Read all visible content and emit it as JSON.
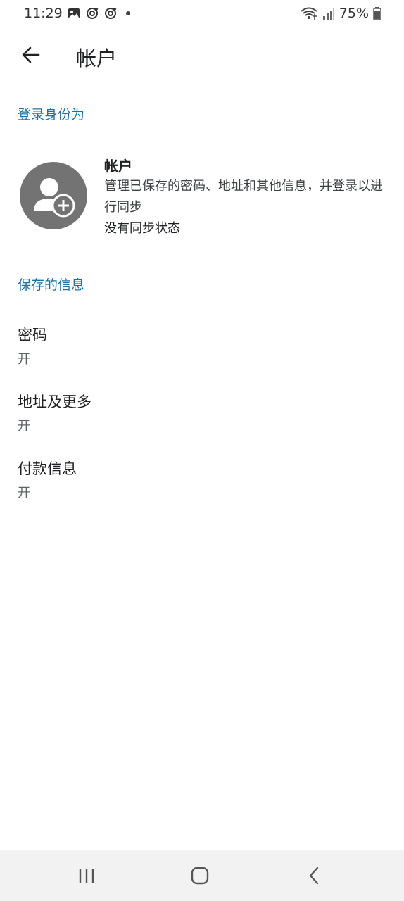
{
  "status_bar": {
    "time": "11:29",
    "battery": "75%",
    "icons": [
      "gallery-icon",
      "sync-icon",
      "sync-icon",
      "notification-dot",
      "wifi-icon",
      "signal-icon",
      "battery-icon"
    ]
  },
  "app_bar": {
    "title": "帐户",
    "back_icon": "arrow-left-icon"
  },
  "sections": {
    "signin_header": "登录身份为",
    "saved_header": "保存的信息"
  },
  "account": {
    "title": "帐户",
    "description": "管理已保存的密码、地址和其他信息，并登录以进行同步",
    "status": "没有同步状态",
    "avatar_icon": "add-account-icon"
  },
  "saved_items": [
    {
      "title": "密码",
      "value": "开"
    },
    {
      "title": "地址及更多",
      "value": "开"
    },
    {
      "title": "付款信息",
      "value": "开"
    }
  ],
  "nav": {
    "recent_icon": "recent-apps-icon",
    "home_icon": "home-icon",
    "back_icon": "back-chevron-icon"
  },
  "colors": {
    "accent": "#1a73a8",
    "avatar": "#737373",
    "nav_background": "#f2f2f2"
  }
}
